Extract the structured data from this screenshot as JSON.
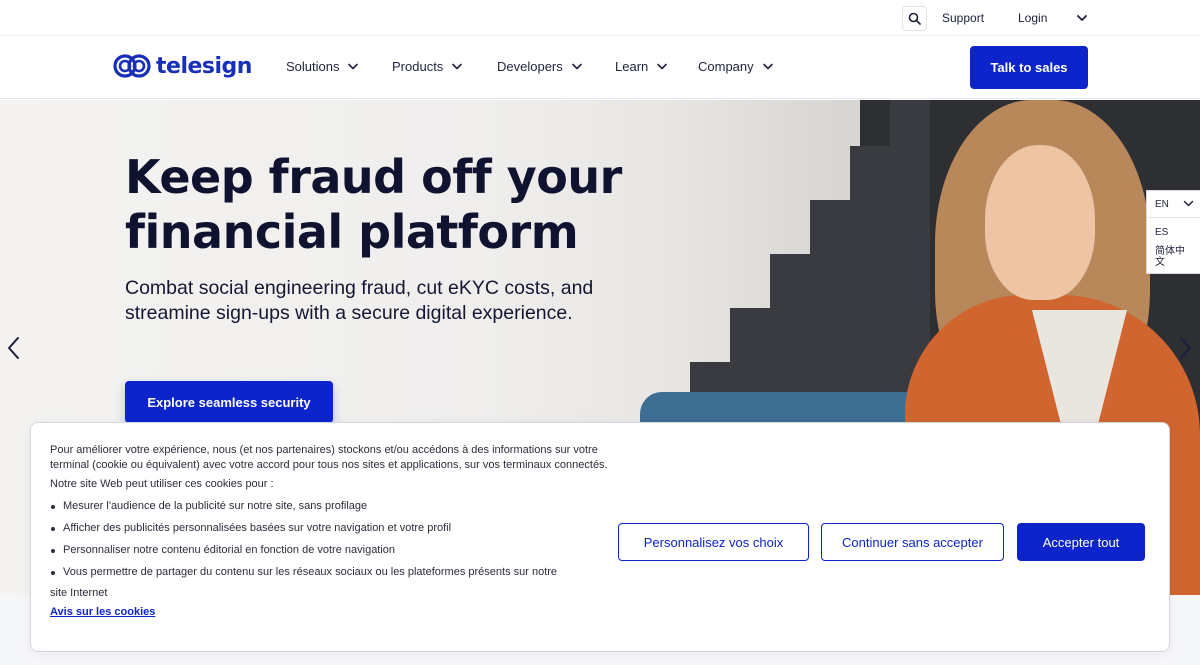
{
  "utility_bar": {
    "support_label": "Support",
    "login_label": "Login"
  },
  "brand": {
    "name": "telesign",
    "accent_color": "#0c24c9"
  },
  "nav": {
    "items": [
      {
        "label": "Solutions"
      },
      {
        "label": "Products"
      },
      {
        "label": "Developers"
      },
      {
        "label": "Learn"
      },
      {
        "label": "Company"
      }
    ],
    "cta_label": "Talk to sales"
  },
  "hero": {
    "title_line1": "Keep fraud off your",
    "title_line2": "financial platform",
    "subtitle": "Combat social engineering fraud, cut eKYC costs, and streamine sign-ups with a secure digital experience.",
    "button_label": "Explore seamless security"
  },
  "language": {
    "current": "EN",
    "options": [
      "ES",
      "简体中文"
    ]
  },
  "cookie": {
    "intro": "Pour améliorer votre expérience, nous (et nos partenaires) stockons et/ou accédons à des informations sur votre terminal (cookie ou équivalent) avec votre accord pour tous nos sites et applications, sur vos terminaux connectés.",
    "purpose_intro": "Notre site Web peut utiliser ces cookies pour :",
    "purposes": [
      "Mesurer l'audience de la publicité sur notre site, sans profilage",
      "Afficher des publicités personnalisées basées sur votre navigation et votre profil",
      "Personnaliser notre contenu éditorial en fonction de votre navigation",
      "Vous permettre de partager du contenu sur les réseaux sociaux ou les plateformes présents sur notre"
    ],
    "purpose_tail": "site Internet",
    "notice_link": "Avis sur les cookies",
    "customize_label": "Personnalisez vos choix",
    "continue_label": "Continuer sans accepter",
    "accept_label": "Accepter tout"
  }
}
